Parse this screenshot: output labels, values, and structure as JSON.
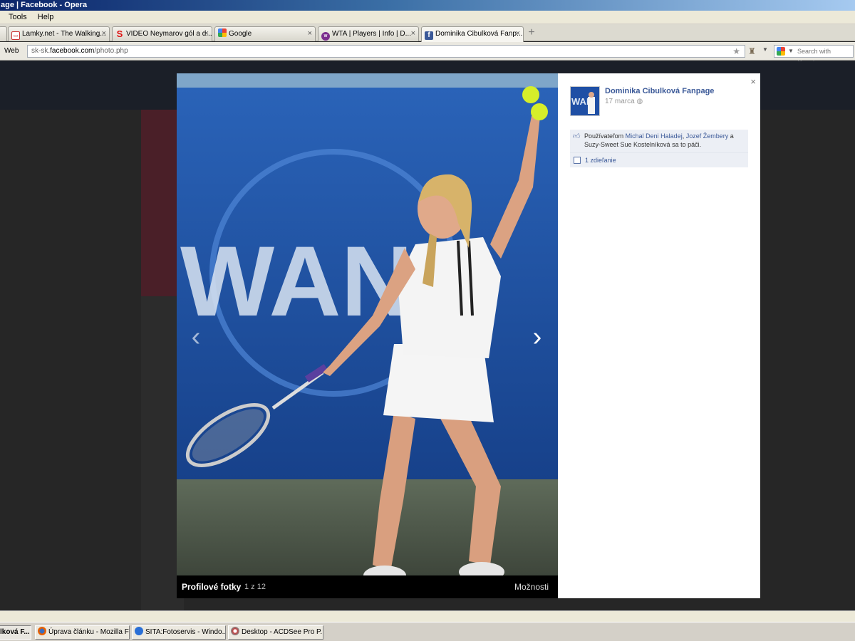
{
  "window": {
    "title": "age | Facebook - Opera"
  },
  "menu": {
    "items": [
      "Tools",
      "Help"
    ]
  },
  "tabs": [
    {
      "label": "Lamky.net - The Walking...",
      "icon": "tv-icon"
    },
    {
      "label": "VIDEO Neymarov gól a d...",
      "icon": "sport-s-icon"
    },
    {
      "label": "Google",
      "icon": "google-icon"
    },
    {
      "label": "WTA | Players | Info | D...",
      "icon": "wta-icon"
    },
    {
      "label": "Dominika Cibulková Fanp...",
      "icon": "facebook-icon"
    }
  ],
  "address": {
    "web_label": "Web",
    "url_prefix": "sk-sk.",
    "url_domain": "facebook.com",
    "url_path": "/photo.php",
    "search_placeholder": "Search with Google"
  },
  "photo_viewer": {
    "wall_text": "WAN",
    "album_name": "Profilové fotky",
    "position": "1 z 12",
    "options_label": "Možnosti",
    "prev_glyph": "‹",
    "next_glyph": "›"
  },
  "side_panel": {
    "close_glyph": "×",
    "avatar_text": "WAN",
    "page_name": "Dominika Cibulková Fanpage",
    "date": "17 marca",
    "likes_prefix": "Používateľom ",
    "liker_1": "Michal Deni Haladej",
    "separator": ", ",
    "liker_2": "Jozef Žembery",
    "likes_mid": " a",
    "likes_suffix": "Suzy-Sweet Sue Kostelníková sa to páči.",
    "shares": "1 zdieľanie"
  },
  "taskbar": [
    {
      "label": "lková F...",
      "active": true
    },
    {
      "label": "Úprava článku - Mozilla Fi...",
      "active": false
    },
    {
      "label": "SITA:Fotoservis - Windo...",
      "active": false
    },
    {
      "label": "Desktop - ACDSee Pro P...",
      "active": false
    }
  ],
  "colors": {
    "facebook_blue": "#3b5998",
    "court_blue": "#1f4fa5",
    "titlebar": "#0a246a"
  }
}
